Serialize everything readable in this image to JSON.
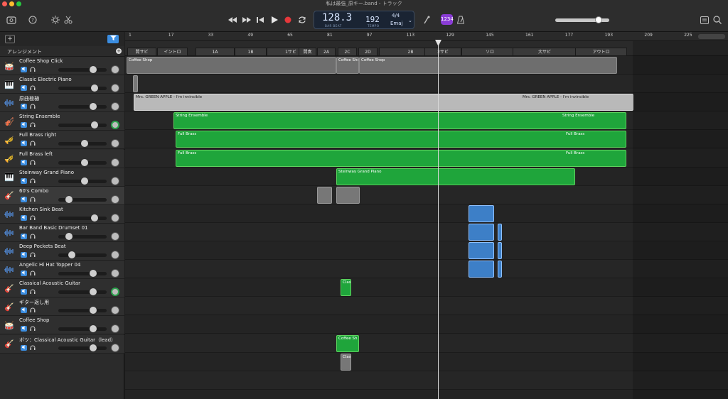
{
  "window": {
    "title": "私は最強_原キー.band - トラック"
  },
  "toolbar": {
    "lcd": {
      "position": "128.3",
      "position_sub": "BAR  BEAT",
      "tempo": "192",
      "tempo_sub": "TEMPO",
      "time_sig": "4/4",
      "key": "Emaj"
    },
    "badge": "1234"
  },
  "tracks_panel": {
    "add_label": "+",
    "arrangement_label": "アレンジメント",
    "add_arrangement": "+"
  },
  "tracks": [
    {
      "name": "Coffee Shop Click",
      "icon": "drum-machine-icon"
    },
    {
      "name": "Classic Electric Piano",
      "icon": "piano-icon"
    },
    {
      "name": "原曲極樋",
      "icon": "audio-waveform-icon"
    },
    {
      "name": "String Ensemble",
      "icon": "violin-icon"
    },
    {
      "name": "Full Brass right",
      "icon": "brass-icon"
    },
    {
      "name": "Full Brass left",
      "icon": "brass-icon"
    },
    {
      "name": "Steinway Grand Piano",
      "icon": "grand-piano-icon"
    },
    {
      "name": "60's Combo",
      "icon": "guitar-icon"
    },
    {
      "name": "Kitchen Sink Beat",
      "icon": "audio-waveform-icon"
    },
    {
      "name": "Bar Band Basic Drumset 01",
      "icon": "audio-waveform-icon"
    },
    {
      "name": "Deep Pockets Beat",
      "icon": "audio-waveform-icon"
    },
    {
      "name": "Angelic Hi Hat Topper 04",
      "icon": "audio-waveform-icon"
    },
    {
      "name": "Classical Acoustic Guitar",
      "icon": "acoustic-guitar-icon"
    },
    {
      "name": "ギター返し用",
      "icon": "electric-guitar-icon"
    },
    {
      "name": "Coffee Shop",
      "icon": "drum-machine-icon"
    },
    {
      "name": "ボツ：Classical Acoustic Guitar（lead）",
      "icon": "acoustic-guitar-icon"
    }
  ],
  "ruler": [
    "1",
    "17",
    "33",
    "49",
    "65",
    "81",
    "97",
    "113",
    "129",
    "145",
    "161",
    "177",
    "193",
    "209",
    "225"
  ],
  "markers": [
    "間サビ",
    "イントロ",
    "1A",
    "1B",
    "1サビ",
    "間奏",
    "2A",
    "2C",
    "2D",
    "2B",
    "2サビ",
    "ソロ",
    "大サビ",
    "アウトロ"
  ],
  "regions": {
    "coffee_shop_click": [
      "Coffee Shop",
      "Coffee Shop",
      "Coffee Shop"
    ],
    "original": [
      "Mrs. GREEN APPLE - I'm invincible",
      "Mrs. GREEN APPLE - I'm invincible"
    ],
    "strings": [
      "String Ensemble",
      "String Ensemble"
    ],
    "brass_r": [
      "Full Brass",
      "Full Brass"
    ],
    "brass_l": [
      "Full Brass",
      "Full Brass"
    ],
    "piano": "Steinway Grand Piano",
    "guitar_cla": "Clas",
    "coffee_shop2": "Coffee Sh",
    "bots": "Clas"
  },
  "colors": {
    "midi_green": "#1fa53b",
    "audio_blue": "#3d7fc7",
    "accent_blue": "#3b8de0",
    "record_red": "#e5383b",
    "badge_purple": "#8a3cd6"
  }
}
